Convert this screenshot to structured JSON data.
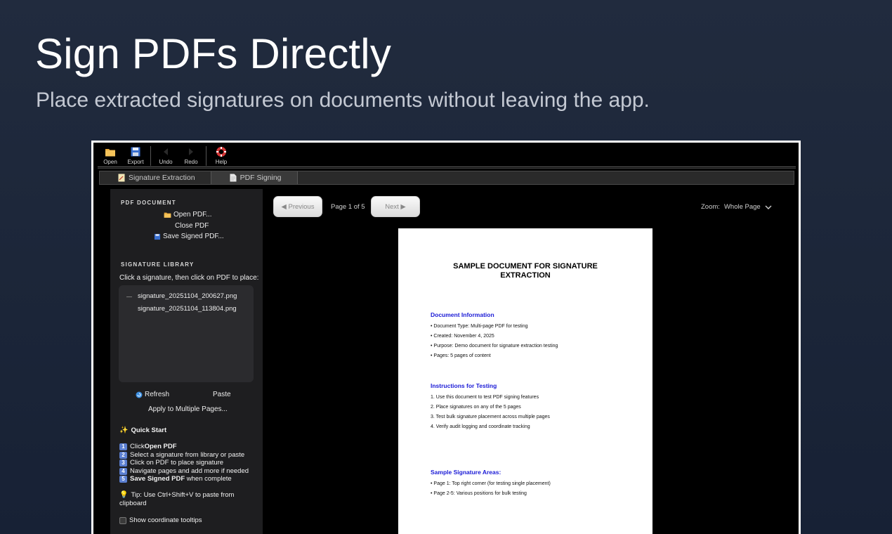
{
  "hero": {
    "title": "Sign PDFs Directly",
    "subtitle": "Place extracted signatures on documents without leaving the app."
  },
  "toolbar": {
    "buttons": [
      {
        "label": "Open",
        "icon": "folder-icon"
      },
      {
        "label": "Export",
        "icon": "save-icon"
      },
      {
        "label": "Undo",
        "icon": "undo-icon"
      },
      {
        "label": "Redo",
        "icon": "redo-icon"
      },
      {
        "label": "Help",
        "icon": "lifebuoy-icon"
      }
    ]
  },
  "tabs": [
    {
      "label": "Signature Extraction",
      "icon": "pencil-doc-icon"
    },
    {
      "label": "PDF Signing",
      "icon": "document-icon"
    }
  ],
  "sidebar": {
    "pdf_header": "PDF DOCUMENT",
    "open_pdf": "Open PDF...",
    "close_pdf": "Close PDF",
    "save_signed": "Save Signed PDF...",
    "library_header": "SIGNATURE LIBRARY",
    "library_hint": "Click a signature, then click on PDF to place:",
    "signatures": [
      "signature_20251104_200627.png",
      "signature_20251104_113804.png"
    ],
    "refresh": "Refresh",
    "paste": "Paste",
    "apply_multiple": "Apply to Multiple Pages...",
    "quick_start_title": "Quick Start",
    "quick_start": [
      {
        "num": "1",
        "pre": "Click ",
        "bold": "Open PDF",
        "post": ""
      },
      {
        "num": "2",
        "pre": "Select a signature from library or paste",
        "bold": "",
        "post": ""
      },
      {
        "num": "3",
        "pre": "Click on PDF to place signature",
        "bold": "",
        "post": ""
      },
      {
        "num": "4",
        "pre": "Navigate pages and add more if needed",
        "bold": "",
        "post": ""
      },
      {
        "num": "5",
        "pre": "",
        "bold": "Save Signed PDF",
        "post": " when complete"
      }
    ],
    "tip_line1": "Tip: Use Ctrl+Shift+V to paste from",
    "tip_line2": "clipboard",
    "show_tooltips": "Show coordinate tooltips"
  },
  "viewer": {
    "previous": "◀ Previous",
    "page_indicator": "Page 1 of 5",
    "next": "Next ▶",
    "zoom_label": "Zoom:",
    "zoom_value": "Whole Page"
  },
  "document": {
    "title_line1": "SAMPLE DOCUMENT FOR SIGNATURE",
    "title_line2": "EXTRACTION",
    "info_heading": "Document Information",
    "info_lines": [
      "• Document Type: Multi-page PDF for testing",
      "• Created: November 4, 2025",
      "• Purpose: Demo document for signature extraction testing",
      "• Pages: 5 pages of content"
    ],
    "instructions_heading": "Instructions for Testing",
    "instructions_lines": [
      "1. Use this document to test PDF signing features",
      "2. Place signatures on any of the 5 pages",
      "3. Test bulk signature placement across multiple pages",
      "4. Verify audit logging and coordinate tracking"
    ],
    "areas_heading": "Sample Signature Areas:",
    "areas_lines": [
      "• Page 1: Top right corner (for testing single placement)",
      "• Page 2-5: Various positions for bulk testing"
    ]
  }
}
